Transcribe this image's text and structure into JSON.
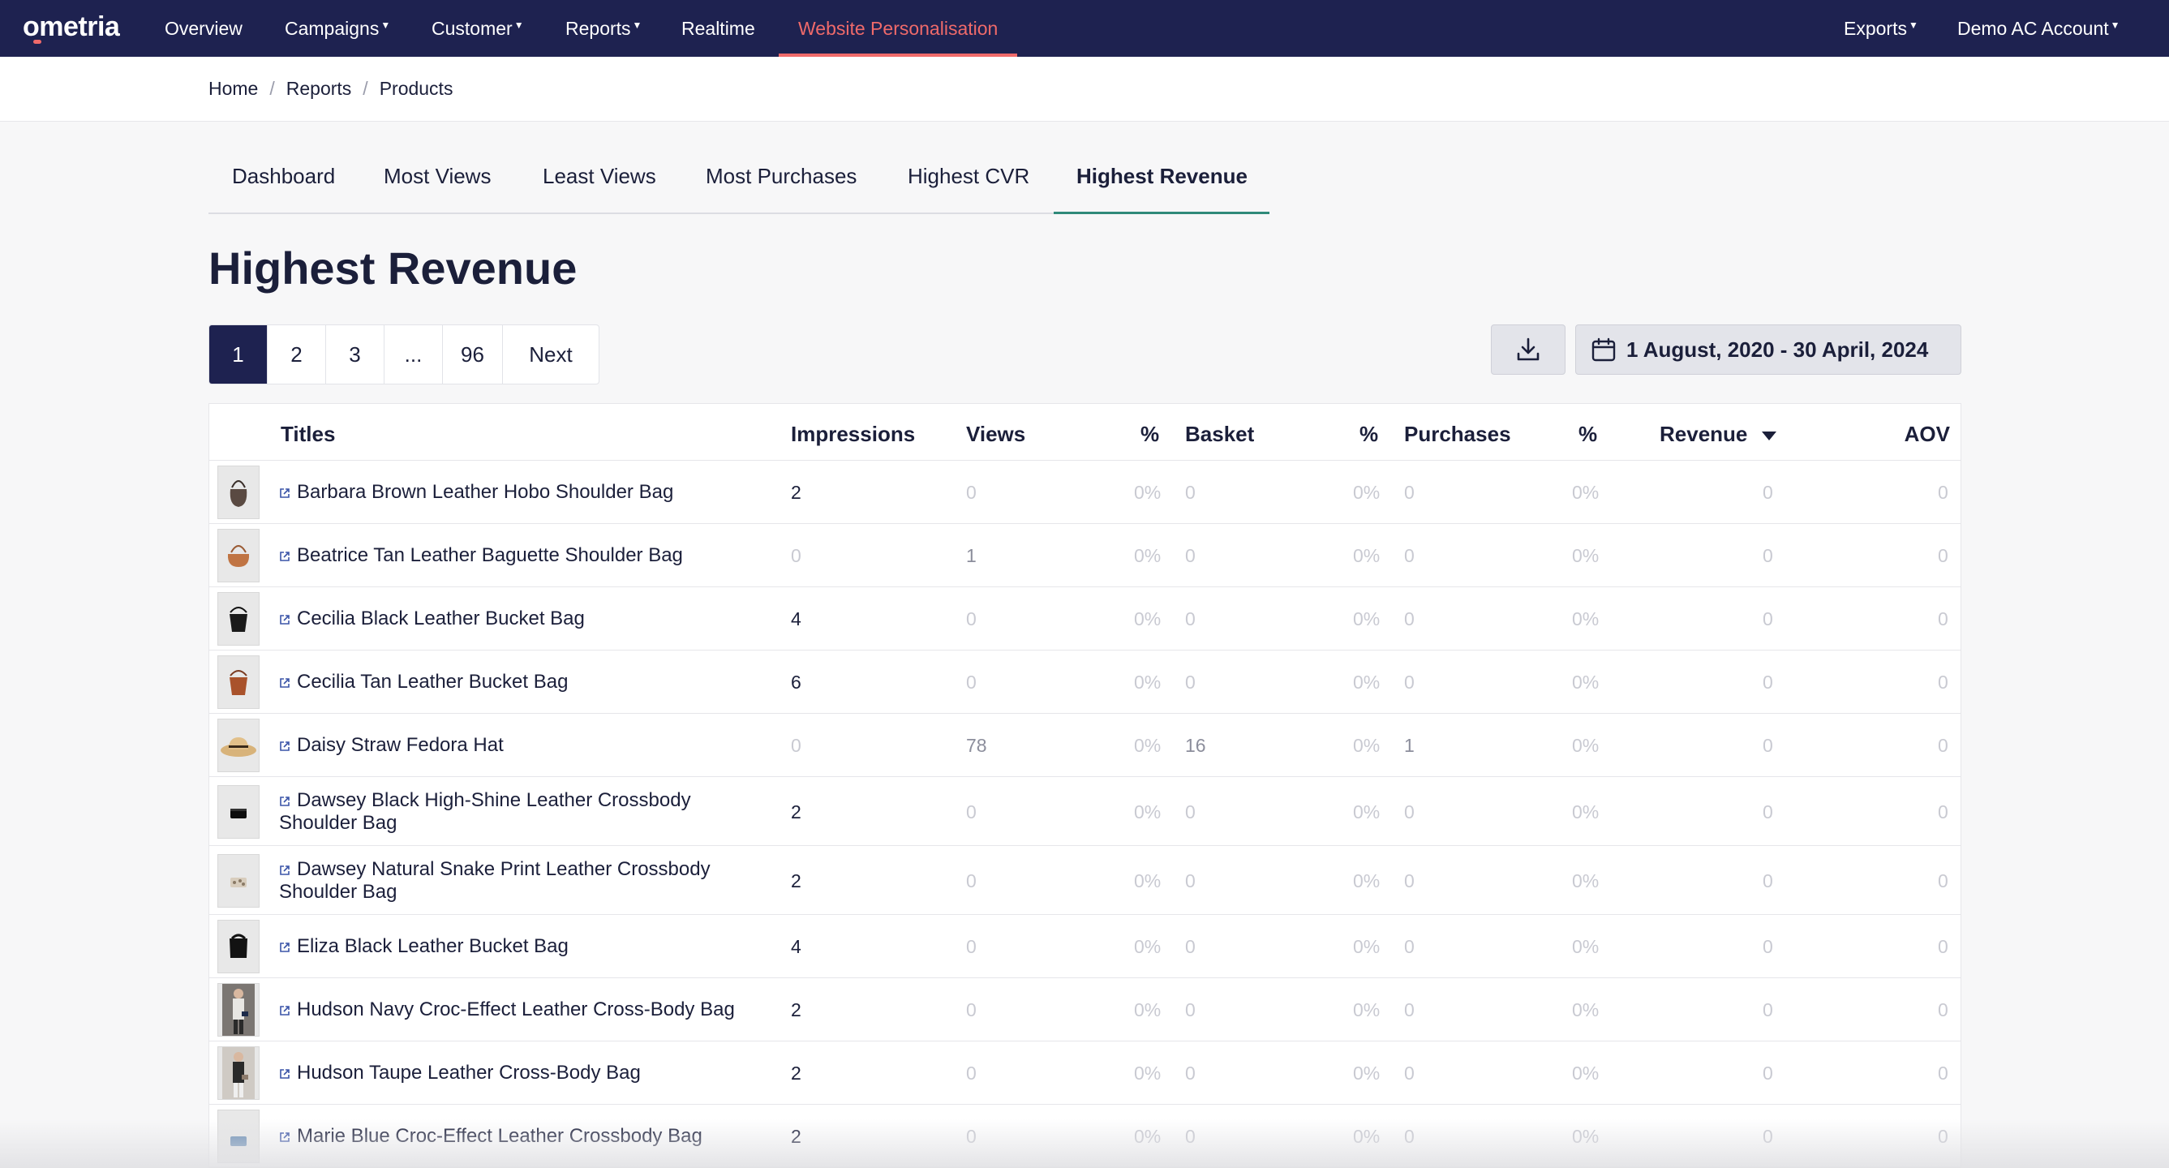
{
  "brand": {
    "logo_text": "ometria",
    "nav_bg": "#1e2250",
    "accent": "#ef6a6a",
    "tab_accent": "#2f8a7a"
  },
  "nav": {
    "items": [
      {
        "label": "Overview",
        "has_caret": false
      },
      {
        "label": "Campaigns",
        "has_caret": true
      },
      {
        "label": "Customer",
        "has_caret": true
      },
      {
        "label": "Reports",
        "has_caret": true
      },
      {
        "label": "Realtime",
        "has_caret": false
      },
      {
        "label": "Website Personalisation",
        "has_caret": false,
        "active": true
      }
    ],
    "right": [
      {
        "label": "Exports",
        "has_caret": true
      },
      {
        "label": "Demo AC Account",
        "has_caret": true
      }
    ]
  },
  "breadcrumb": [
    "Home",
    "Reports",
    "Products"
  ],
  "tabs": [
    "Dashboard",
    "Most Views",
    "Least Views",
    "Most Purchases",
    "Highest CVR",
    "Highest Revenue"
  ],
  "active_tab": "Highest Revenue",
  "page_title": "Highest Revenue",
  "pagination": {
    "pages": [
      "1",
      "2",
      "3",
      "...",
      "96"
    ],
    "next": "Next",
    "current": "1"
  },
  "date_range": "1 August, 2020 - 30 April, 2024",
  "table": {
    "headers": {
      "titles": "Titles",
      "impressions": "Impressions",
      "views": "Views",
      "views_pct": "%",
      "basket": "Basket",
      "basket_pct": "%",
      "purchases": "Purchases",
      "purchases_pct": "%",
      "revenue": "Revenue",
      "aov": "AOV"
    },
    "rows": [
      {
        "thumb": "hobo-bag",
        "title": "Barbara Brown Leather Hobo Shoulder Bag",
        "impressions": "2",
        "views": "0",
        "views_pct": "0%",
        "basket": "0",
        "basket_pct": "0%",
        "purchases": "0",
        "purchases_pct": "0%",
        "revenue": "0",
        "aov": "0"
      },
      {
        "thumb": "baguette-bag",
        "title": "Beatrice Tan Leather Baguette Shoulder Bag",
        "impressions": "0",
        "views": "1",
        "views_pct": "0%",
        "basket": "0",
        "basket_pct": "0%",
        "purchases": "0",
        "purchases_pct": "0%",
        "revenue": "0",
        "aov": "0"
      },
      {
        "thumb": "bucket-bag-black",
        "title": "Cecilia Black Leather Bucket Bag",
        "impressions": "4",
        "views": "0",
        "views_pct": "0%",
        "basket": "0",
        "basket_pct": "0%",
        "purchases": "0",
        "purchases_pct": "0%",
        "revenue": "0",
        "aov": "0"
      },
      {
        "thumb": "bucket-bag-tan",
        "title": "Cecilia Tan Leather Bucket Bag",
        "impressions": "6",
        "views": "0",
        "views_pct": "0%",
        "basket": "0",
        "basket_pct": "0%",
        "purchases": "0",
        "purchases_pct": "0%",
        "revenue": "0",
        "aov": "0"
      },
      {
        "thumb": "straw-hat",
        "title": "Daisy Straw Fedora Hat",
        "impressions": "0",
        "views": "78",
        "views_pct": "0%",
        "basket": "16",
        "basket_pct": "0%",
        "purchases": "1",
        "purchases_pct": "0%",
        "revenue": "0",
        "aov": "0"
      },
      {
        "thumb": "crossbody-black",
        "title": "Dawsey Black High-Shine Leather Crossbody Shoulder Bag",
        "impressions": "2",
        "views": "0",
        "views_pct": "0%",
        "basket": "0",
        "basket_pct": "0%",
        "purchases": "0",
        "purchases_pct": "0%",
        "revenue": "0",
        "aov": "0"
      },
      {
        "thumb": "crossbody-snake",
        "title": "Dawsey Natural Snake Print Leather Crossbody Shoulder Bag",
        "impressions": "2",
        "views": "0",
        "views_pct": "0%",
        "basket": "0",
        "basket_pct": "0%",
        "purchases": "0",
        "purchases_pct": "0%",
        "revenue": "0",
        "aov": "0"
      },
      {
        "thumb": "bucket-bag-eliza",
        "title": "Eliza Black Leather Bucket Bag",
        "impressions": "4",
        "views": "0",
        "views_pct": "0%",
        "basket": "0",
        "basket_pct": "0%",
        "purchases": "0",
        "purchases_pct": "0%",
        "revenue": "0",
        "aov": "0"
      },
      {
        "thumb": "model-navy",
        "title": "Hudson Navy Croc-Effect Leather Cross-Body Bag",
        "impressions": "2",
        "views": "0",
        "views_pct": "0%",
        "basket": "0",
        "basket_pct": "0%",
        "purchases": "0",
        "purchases_pct": "0%",
        "revenue": "0",
        "aov": "0"
      },
      {
        "thumb": "model-taupe",
        "title": "Hudson Taupe Leather Cross-Body Bag",
        "impressions": "2",
        "views": "0",
        "views_pct": "0%",
        "basket": "0",
        "basket_pct": "0%",
        "purchases": "0",
        "purchases_pct": "0%",
        "revenue": "0",
        "aov": "0"
      },
      {
        "thumb": "crossbody-blue",
        "title": "Marie Blue Croc-Effect Leather Crossbody Bag",
        "impressions": "2",
        "views": "0",
        "views_pct": "0%",
        "basket": "0",
        "basket_pct": "0%",
        "purchases": "0",
        "purchases_pct": "0%",
        "revenue": "0",
        "aov": "0"
      }
    ]
  }
}
